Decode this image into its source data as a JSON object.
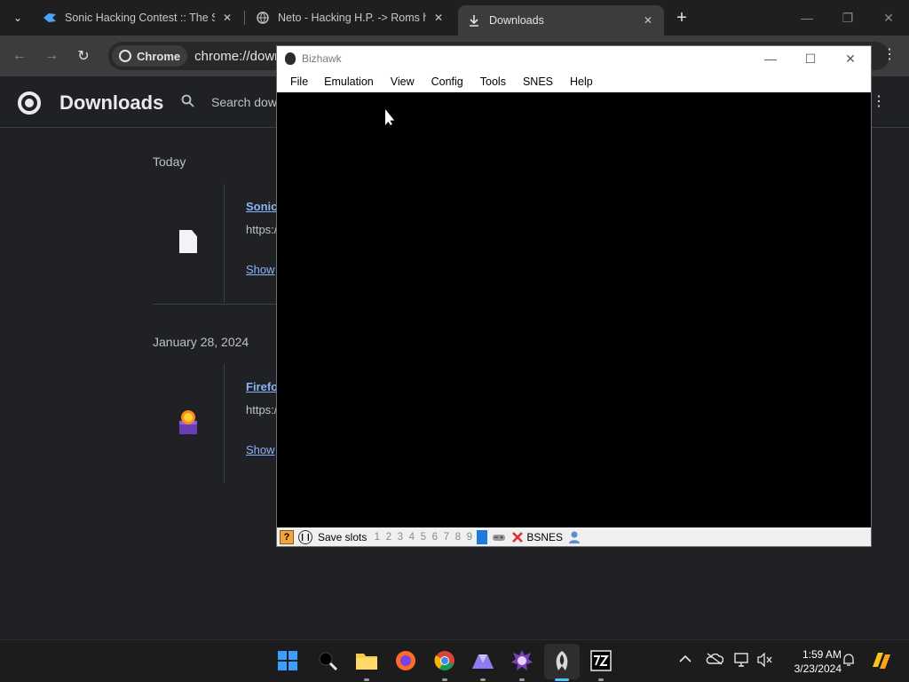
{
  "chrome": {
    "tabs": [
      {
        "title": "Sonic Hacking Contest :: The SHC",
        "favicon": "sonic-icon"
      },
      {
        "title": "Neto - Hacking H.P. -> Roms hac",
        "favicon": "globe-icon"
      },
      {
        "title": "Downloads",
        "favicon": "download-icon",
        "active": true
      }
    ],
    "new_tab": "+",
    "chip_label": "Chrome",
    "url": "chrome://downloads"
  },
  "downloads": {
    "title": "Downloads",
    "search_placeholder": "Search downloads",
    "groups": [
      {
        "date": "Today",
        "item": {
          "name": "Sonic",
          "source": "https:/",
          "action": "Show"
        }
      },
      {
        "date": "January 28, 2024",
        "item": {
          "name": "Firefo",
          "source": "https:/",
          "action": "Show"
        }
      }
    ]
  },
  "bizhawk": {
    "title": "Bizhawk",
    "menu": [
      "File",
      "Emulation",
      "View",
      "Config",
      "Tools",
      "SNES",
      "Help"
    ],
    "status": {
      "save_slots_label": "Save slots",
      "slots": [
        "1",
        "2",
        "3",
        "4",
        "5",
        "6",
        "7",
        "8",
        "9"
      ],
      "core": "BSNES"
    }
  },
  "taskbar": {
    "time": "1:59 AM",
    "date": "3/23/2024"
  },
  "colors": {
    "chrome_bg": "#202124",
    "link": "#8ab4f8",
    "slot_selected": "#1f7ae0",
    "taskbar_accent": "#4cc2ff"
  }
}
